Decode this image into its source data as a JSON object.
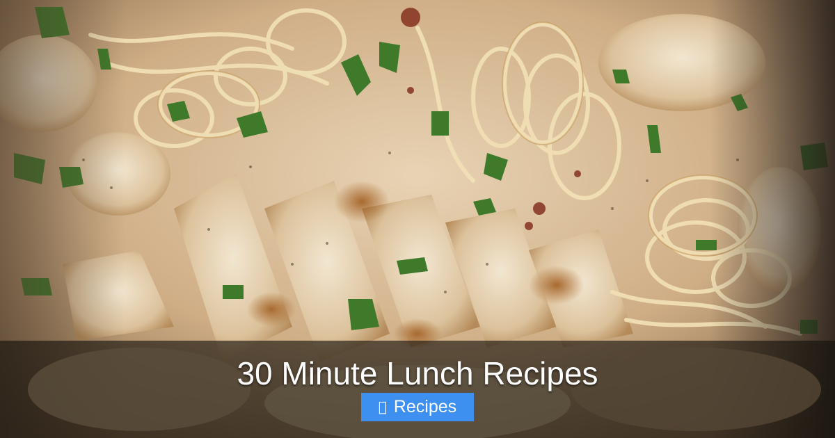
{
  "post": {
    "title": "30 Minute Lunch Recipes",
    "category_label": "Recipes",
    "category_icon_glyph": ""
  },
  "icons": {
    "category_icon": "folder-icon"
  },
  "colors": {
    "banner_overlay": "#14100c",
    "category_badge": "#3d8ff0",
    "title_text": "#ffffff"
  }
}
